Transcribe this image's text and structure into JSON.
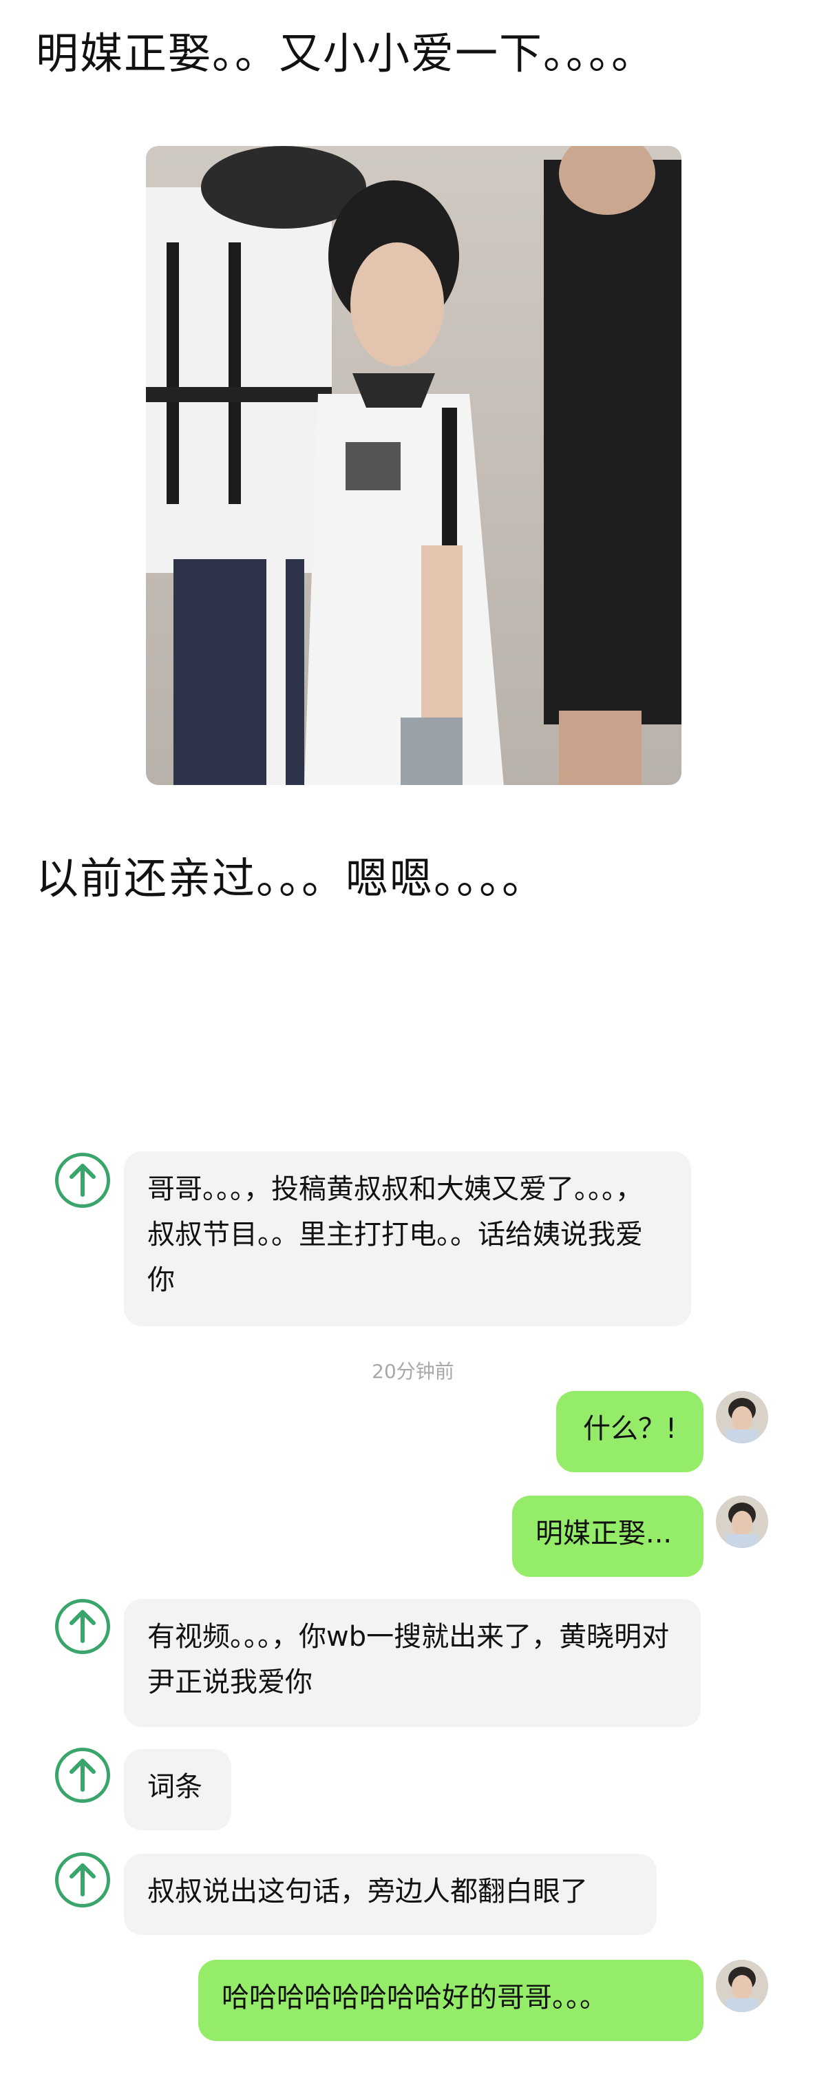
{
  "captions": {
    "top": "明媒正娶。。又小小爱一下。。。。",
    "middle": "以前还亲过。。。嗯嗯。。。。"
  },
  "photo": {
    "description_icon": "photo-image"
  },
  "chat": {
    "timestamp": "20分钟前",
    "messages": [
      {
        "side": "in",
        "text": "哥哥。。。，投稿黄叔叔和大姨又爱了。。。，叔叔节目。。里主打打电。。话给姨说我爱你"
      },
      {
        "side": "out",
        "text": "什么？!"
      },
      {
        "side": "out",
        "text": "明媒正娶..."
      },
      {
        "side": "in",
        "text": "有视频。。。，你wb一搜就出来了，黄晓明对尹正说我爱你"
      },
      {
        "side": "in",
        "text": "词条"
      },
      {
        "side": "in",
        "text": "叔叔说出这句话，旁边人都翻白眼了"
      },
      {
        "side": "out",
        "text": "哈哈哈哈哈哈哈哈好的哥哥。。。"
      }
    ]
  },
  "colors": {
    "out_bubble": "#95ec69",
    "in_bubble": "#f3f3f3",
    "bot_icon": "#3aa56a",
    "timestamp": "#a8a8a8"
  },
  "icons": {
    "bot_avatar": "up-arrow-circle-icon",
    "user_avatar": "user-avatar-photo"
  }
}
